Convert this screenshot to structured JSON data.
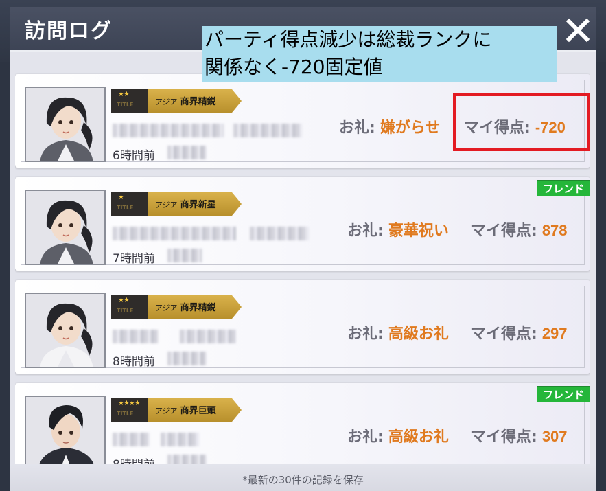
{
  "dialog": {
    "title": "訪問ログ",
    "close_icon": "close-icon"
  },
  "annotation": {
    "line1": "パーティ得点減少は総裁ランクに",
    "line2": "関係なく-720固定値"
  },
  "entries": [
    {
      "stars": "★★",
      "title_tag": "TITLE",
      "region": "アジア",
      "rank": "商界精鋭",
      "time": "6時間前",
      "gift_label": "お礼:",
      "gift_value": "嫌がらせ",
      "score_label": "マイ得点:",
      "score_value": "-720",
      "friend": ""
    },
    {
      "stars": "★",
      "title_tag": "TITLE",
      "region": "アジア",
      "rank": "商界新星",
      "time": "7時間前",
      "gift_label": "お礼:",
      "gift_value": "豪華祝い",
      "score_label": "マイ得点:",
      "score_value": "878",
      "friend": "フレンド"
    },
    {
      "stars": "★★",
      "title_tag": "TITLE",
      "region": "アジア",
      "rank": "商界精鋭",
      "time": "8時間前",
      "gift_label": "お礼:",
      "gift_value": "高級お礼",
      "score_label": "マイ得点:",
      "score_value": "297",
      "friend": ""
    },
    {
      "stars": "★★★★",
      "title_tag": "TITLE",
      "region": "アジア",
      "rank": "商界巨頭",
      "time": "8時間前",
      "gift_label": "お礼:",
      "gift_value": "高級お礼",
      "score_label": "マイ得点:",
      "score_value": "307",
      "friend": "フレンド"
    }
  ],
  "footer": {
    "note": "*最新の30件の記録を保存"
  },
  "colors": {
    "accent": "#e07a1f",
    "friend_green": "#25b63a",
    "highlight_red": "#e31b23",
    "annotation_bg": "#a8ddee"
  }
}
